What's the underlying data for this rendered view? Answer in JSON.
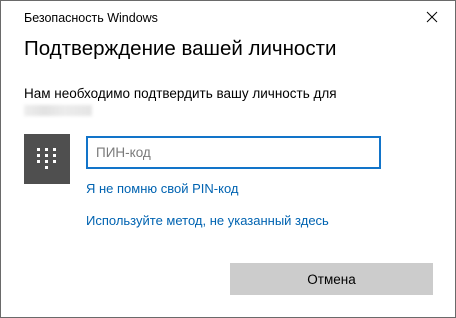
{
  "window": {
    "title": "Безопасность Windows"
  },
  "dialog": {
    "heading": "Подтверждение вашей личности",
    "message": "Нам необходимо подтвердить вашу личность для",
    "pin_placeholder": "ПИН-код",
    "pin_value": "",
    "forgot_pin_link": "Я не помню свой PIN-код",
    "other_method_link": "Используйте метод, не указанный здесь",
    "cancel_label": "Отмена"
  },
  "icons": {
    "close": "close-icon",
    "keypad": "keypad-icon"
  },
  "colors": {
    "accent": "#1274c9",
    "link": "#0063b1",
    "keypad_tile": "#4f4f4f",
    "button": "#cccccc"
  }
}
